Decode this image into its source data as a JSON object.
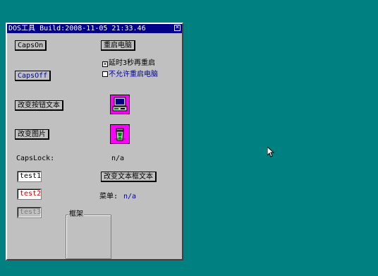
{
  "window": {
    "title": "DOS工具 Build:2008-11-05 21:33.46",
    "close_glyph": "×"
  },
  "buttons": {
    "caps_on": "CapsOn",
    "restart": "重启电脑",
    "caps_off": "CapsOff",
    "change_button_text": "改变按钮文本",
    "change_image": "改变图片",
    "change_textbox_text": "改变文本框文本"
  },
  "checkboxes": {
    "delay_restart": {
      "label": "延时3秒再重启",
      "checked": true,
      "mark": "×"
    },
    "disallow_restart": {
      "label": "不允许重启电脑",
      "checked": false,
      "mark": ""
    }
  },
  "capslock": {
    "label": "CapsLock:",
    "value": "n/a"
  },
  "fields": {
    "test1": "test1",
    "test2": "test2",
    "test3": "test3"
  },
  "menu": {
    "label": "菜单:",
    "value": "n/a"
  },
  "frame": {
    "title": "框架"
  },
  "icons": {
    "image1": "computer-icon",
    "image2": "recycle-bin-icon",
    "pointer": "mouse-pointer-icon"
  },
  "colors": {
    "desktop": "#008080",
    "window": "#c0c0c0",
    "titlebar": "#000088",
    "accent_blue": "#0000aa",
    "accent_red": "#cc0000",
    "icon_background": "#ff00ff"
  }
}
